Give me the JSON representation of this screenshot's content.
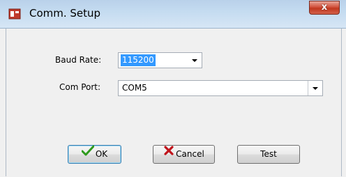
{
  "window": {
    "title": "Comm. Setup",
    "close_label": "x"
  },
  "form": {
    "baud_rate_label": "Baud Rate:",
    "baud_rate_value": "115200",
    "com_port_label": "Com Port:",
    "com_port_value": "COM5"
  },
  "buttons": {
    "ok_label": "OK",
    "cancel_label": "Cancel",
    "test_label": "Test"
  },
  "icons": {
    "app": "app-icon",
    "ok": "checkmark-icon",
    "cancel": "x-mark-icon",
    "dropdown": "chevron-down-icon"
  },
  "colors": {
    "selection": "#3399ff",
    "close_button": "#c1381f",
    "ok_check": "#2e9a1c",
    "cancel_x": "#c0141b"
  }
}
